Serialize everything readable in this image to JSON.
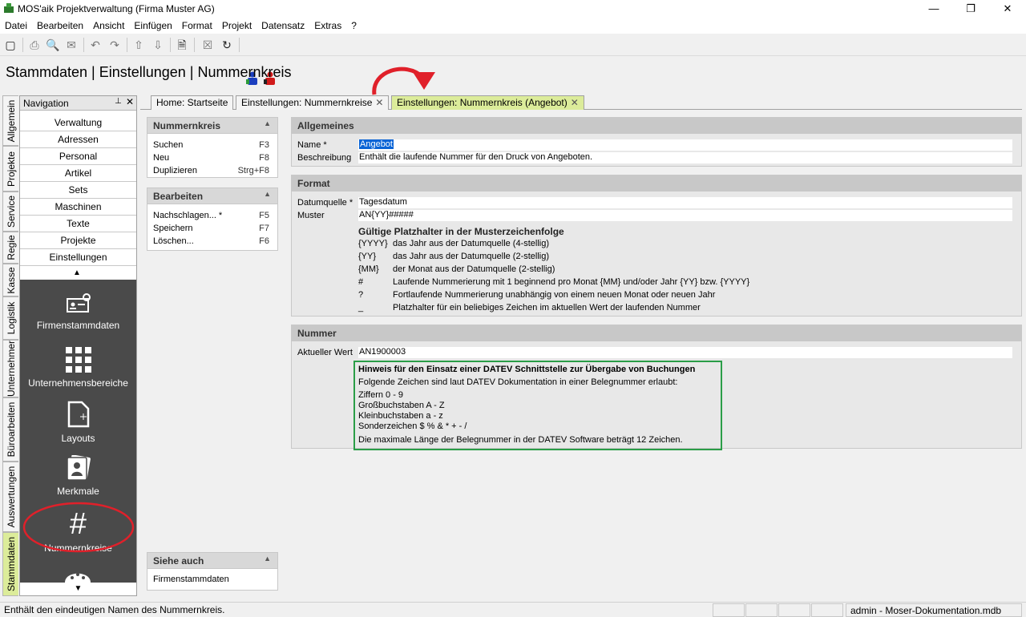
{
  "window": {
    "title": "MOS'aik Projektverwaltung (Firma Muster AG)",
    "minimize": "—",
    "maximize": "❐",
    "close": "✕"
  },
  "menu": [
    "Datei",
    "Bearbeiten",
    "Ansicht",
    "Einfügen",
    "Format",
    "Projekt",
    "Datensatz",
    "Extras",
    "?"
  ],
  "page_title": "Stammdaten | Einstellungen | Nummernkreis",
  "vertical_tabs": [
    "Allgemein",
    "Projekte",
    "Service",
    "Regie",
    "Kasse",
    "Logistik",
    "Unternehmer",
    "Büroarbeiten",
    "Auswertungen",
    "Stammdaten"
  ],
  "navigation": {
    "title": "Navigation",
    "pin": "📌",
    "close": "✕",
    "buttons": [
      "Verwaltung",
      "Adressen",
      "Personal",
      "Artikel",
      "Sets",
      "Maschinen",
      "Texte",
      "Projekte",
      "Einstellungen"
    ],
    "big_items": [
      "Firmenstammdaten",
      "Unternehmensbereiche",
      "Layouts",
      "Merkmale",
      "Nummernkreise"
    ],
    "highlight_color": "#e0202a"
  },
  "doc_tabs": [
    {
      "label": "Home: Startseite",
      "closable": false
    },
    {
      "label": "Einstellungen: Nummernkreise",
      "closable": true
    },
    {
      "label": "Einstellungen: Nummernkreis (Angebot)",
      "closable": true
    }
  ],
  "side_panels": {
    "nummernkreis": {
      "title": "Nummernkreis",
      "rows": [
        {
          "label": "Suchen",
          "key": "F3"
        },
        {
          "label": "Neu",
          "key": "F8"
        },
        {
          "label": "Duplizieren",
          "key": "Strg+F8"
        }
      ]
    },
    "bearbeiten": {
      "title": "Bearbeiten",
      "rows": [
        {
          "label": "Nachschlagen... *",
          "key": "F5"
        },
        {
          "label": "Speichern",
          "key": "F7"
        },
        {
          "label": "Löschen...",
          "key": "F6"
        }
      ]
    },
    "siehe_auch": {
      "title": "Siehe auch",
      "rows": [
        {
          "label": "Firmenstammdaten"
        }
      ]
    }
  },
  "sections": {
    "allgemeines": {
      "title": "Allgemeines",
      "name_label": "Name *",
      "name_value": "Angebot",
      "desc_label": "Beschreibung",
      "desc_value": "Enthält die laufende Nummer für den Druck von Angeboten."
    },
    "format": {
      "title": "Format",
      "datumsquelle_label": "Datumquelle *",
      "datumsquelle_value": "Tagesdatum",
      "muster_label": "Muster",
      "muster_value": "AN{YY}#####",
      "platzhalter_title": "Gültige Platzhalter in der Musterzeichenfolge",
      "platzhalter": [
        {
          "code": "{YYYY}",
          "desc": "das Jahr aus der Datumquelle (4-stellig)"
        },
        {
          "code": "{YY}",
          "desc": "das Jahr aus der Datumquelle (2-stellig)"
        },
        {
          "code": "{MM}",
          "desc": "der Monat aus der Datumquelle (2-stellig)"
        },
        {
          "code": "#",
          "desc": "Laufende Nummerierung mit 1 beginnend pro Monat {MM} und/oder Jahr {YY} bzw. {YYYY}"
        },
        {
          "code": "?",
          "desc": "Fortlaufende Nummerierung unabhängig von einem neuen Monat oder neuen Jahr"
        },
        {
          "code": "_",
          "desc": "Platzhalter für ein beliebiges Zeichen im aktuellen Wert der laufenden Nummer"
        }
      ]
    },
    "nummer": {
      "title": "Nummer",
      "aktuell_label": "Aktueller Wert",
      "aktuell_value": "AN1900003",
      "datev": {
        "title": "Hinweis für den Einsatz einer DATEV Schnittstelle zur Übergabe von Buchungen",
        "intro": "Folgende Zeichen sind laut DATEV Dokumentation in einer Belegnummer erlaubt:",
        "lines": [
          "Ziffern 0 - 9",
          "Großbuchstaben A - Z",
          "Kleinbuchstaben a - z",
          "Sonderzeichen $ % & * + - /"
        ],
        "footer": "Die maximale Länge der Belegnummer in der DATEV Software beträgt 12 Zeichen.",
        "border_color": "#2a9d47"
      }
    }
  },
  "statusbar": {
    "message": "Enthält den eindeutigen Namen des Nummernkreis.",
    "user_db": "admin - Moser-Dokumentation.mdb"
  }
}
